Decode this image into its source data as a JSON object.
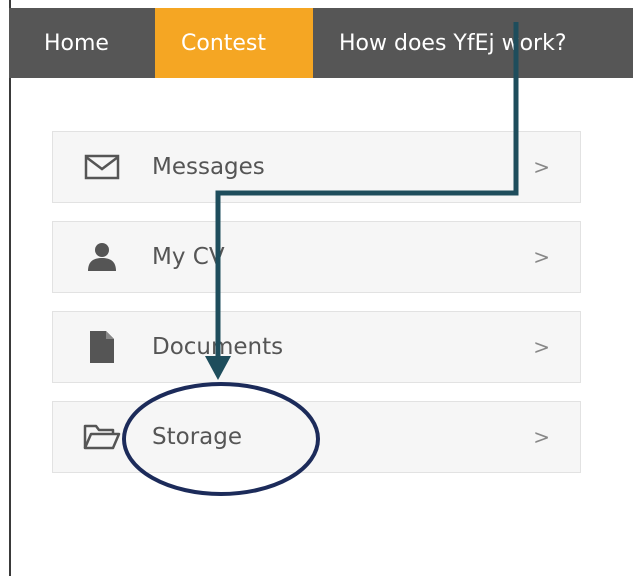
{
  "nav": {
    "items": [
      {
        "label": "Home"
      },
      {
        "label": "Contest",
        "active": true
      },
      {
        "label": "How does YfEj work?"
      }
    ],
    "colors": {
      "bar": "#565656",
      "active": "#f5a623"
    }
  },
  "menu": {
    "items": [
      {
        "label": "Messages",
        "icon": "envelope-icon",
        "chevron": ">"
      },
      {
        "label": "My CV",
        "icon": "user-icon",
        "chevron": ">"
      },
      {
        "label": "Documents",
        "icon": "document-icon",
        "chevron": ">"
      },
      {
        "label": "Storage",
        "icon": "folder-open-icon",
        "chevron": ">"
      }
    ]
  },
  "annotation": {
    "arrow_color": "#1e4d5c",
    "circle_color": "#1c2b5a",
    "highlighted_item": "Storage"
  }
}
